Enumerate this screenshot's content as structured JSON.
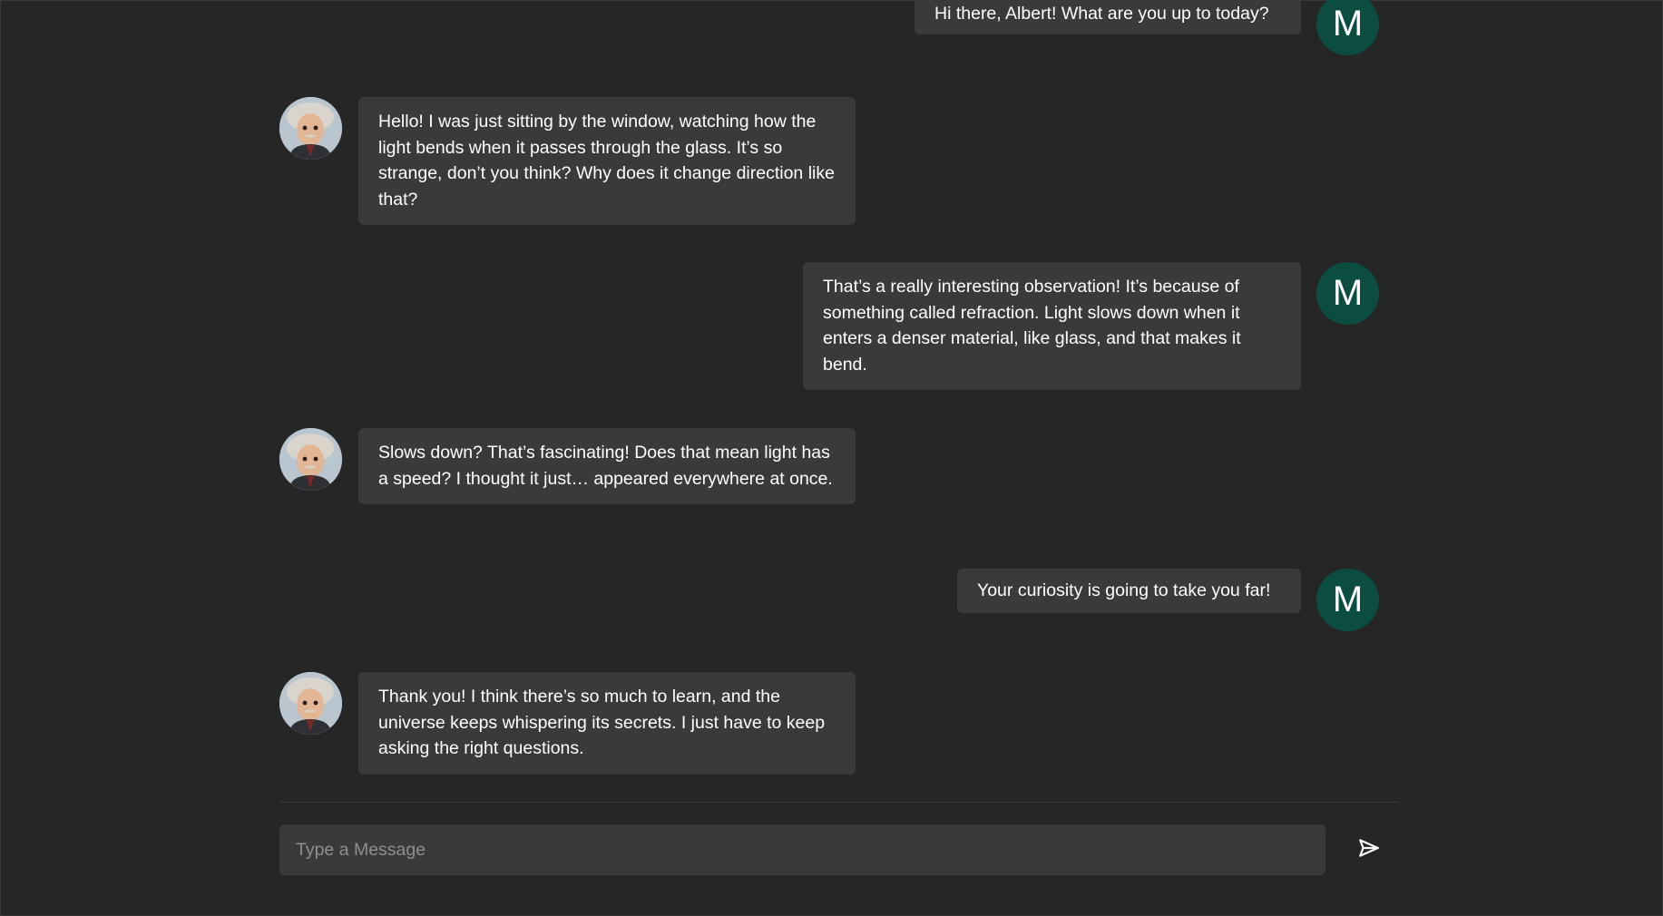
{
  "messages": [
    {
      "role": "user",
      "avatar_letter": "M",
      "text": "Hi there, Albert! What are you up to today?"
    },
    {
      "role": "bot",
      "text": "Hello! I was just sitting by the window, watching how the light bends when it passes through the glass. It’s so strange, don’t you think? Why does it change direction like that?"
    },
    {
      "role": "user",
      "avatar_letter": "M",
      "text": "That’s a really interesting observation! It’s because of something called refraction. Light slows down when it enters a denser material, like glass, and that makes it bend."
    },
    {
      "role": "bot",
      "text": "Slows down? That’s fascinating! Does that mean light has a speed? I thought it just… appeared everywhere at once."
    },
    {
      "role": "user",
      "avatar_letter": "M",
      "text": "Your curiosity is going to take you far!"
    },
    {
      "role": "bot",
      "text": "Thank you! I think there’s so much to learn, and the universe keeps whispering its secrets. I just have to keep asking the right questions."
    }
  ],
  "composer": {
    "placeholder": "Type a Message",
    "send_icon": "send-icon"
  },
  "colors": {
    "background": "#262626",
    "bubble": "#3a3a3a",
    "user_avatar": "#0c4d41",
    "placeholder": "#8f8f8f"
  }
}
